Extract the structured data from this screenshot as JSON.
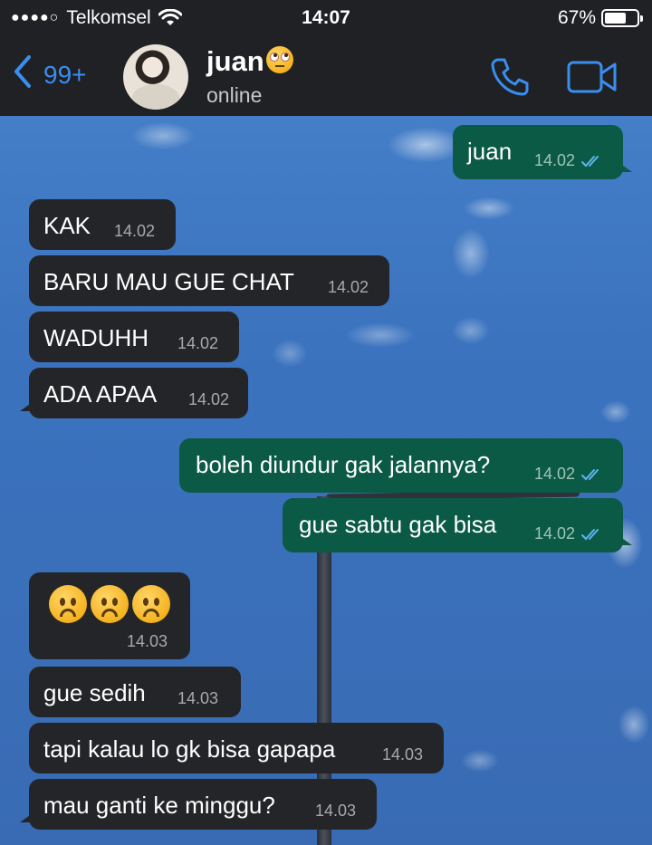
{
  "status_bar": {
    "signal_dots": "●●●●○",
    "carrier": "Telkomsel",
    "time": "14:07",
    "battery_percent": "67%",
    "battery_level": 0.67
  },
  "nav": {
    "back_count": "99+",
    "contact_name": "juan",
    "contact_status": "online",
    "icons": [
      "chevron-left-icon",
      "eye-roll-emoji",
      "phone-icon",
      "video-camera-icon"
    ],
    "accent_color": "#3a8ef0"
  },
  "messages": [
    {
      "direction": "out",
      "text": "juan",
      "time": "14.02",
      "read": true
    },
    {
      "direction": "in",
      "text": "KAK",
      "time": "14.02"
    },
    {
      "direction": "in",
      "text": "BARU MAU GUE CHAT",
      "time": "14.02"
    },
    {
      "direction": "in",
      "text": "WADUHH",
      "time": "14.02"
    },
    {
      "direction": "in",
      "text": "ADA APAA",
      "time": "14.02"
    },
    {
      "direction": "out",
      "text": "boleh diundur gak jalannya?",
      "time": "14.02",
      "read": true
    },
    {
      "direction": "out",
      "text": "gue sabtu gak bisa",
      "time": "14.02",
      "read": true
    },
    {
      "direction": "in",
      "text": "",
      "emoji": [
        "slightly-frowning-face",
        "slightly-frowning-face",
        "slightly-frowning-face"
      ],
      "time": "14.03"
    },
    {
      "direction": "in",
      "text": "gue sedih",
      "time": "14.03"
    },
    {
      "direction": "in",
      "text": "tapi kalau lo gk bisa gapapa",
      "time": "14.03"
    },
    {
      "direction": "in",
      "text": "mau ganti ke minggu?",
      "time": "14.03"
    }
  ],
  "colors": {
    "incoming_bubble": "#242528",
    "outgoing_bubble": "#0b5a45",
    "header_bg": "#1f2124",
    "read_ticks": "#5fb4f0"
  }
}
